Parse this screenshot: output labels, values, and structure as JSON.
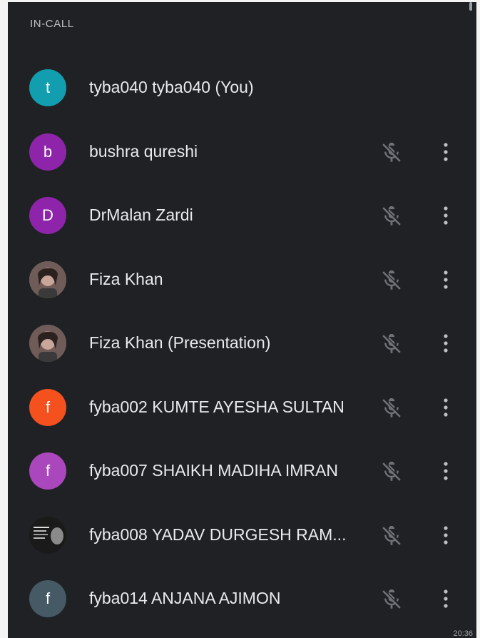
{
  "section_label": "IN-CALL",
  "participants": [
    {
      "name": "tyba040 tyba040 (You)",
      "initial": "t",
      "avatar_color": "#129eaf",
      "avatar_type": "initial",
      "muted": false,
      "has_menu": false
    },
    {
      "name": "bushra qureshi",
      "initial": "b",
      "avatar_color": "#8e24aa",
      "avatar_type": "initial",
      "muted": true,
      "has_menu": true
    },
    {
      "name": "DrMalan Zardi",
      "initial": "D",
      "avatar_color": "#8e24aa",
      "avatar_type": "initial",
      "muted": true,
      "has_menu": true
    },
    {
      "name": "Fiza Khan",
      "initial": "",
      "avatar_color": "#6f5b58",
      "avatar_type": "photo",
      "muted": true,
      "has_menu": true
    },
    {
      "name": "Fiza Khan (Presentation)",
      "initial": "",
      "avatar_color": "#6f5b58",
      "avatar_type": "photo",
      "muted": true,
      "has_menu": true
    },
    {
      "name": "fyba002 KUMTE AYESHA SULTAN",
      "initial": "f",
      "avatar_color": "#f4511e",
      "avatar_type": "initial",
      "muted": true,
      "has_menu": true
    },
    {
      "name": "fyba007 SHAIKH MADIHA IMRAN",
      "initial": "f",
      "avatar_color": "#ab47bc",
      "avatar_type": "initial",
      "muted": true,
      "has_menu": true
    },
    {
      "name": "fyba008 YADAV DURGESH RAM...",
      "initial": "",
      "avatar_color": "#1e1e1e",
      "avatar_type": "poster",
      "muted": true,
      "has_menu": true
    },
    {
      "name": "fyba014 ANJANA AJIMON",
      "initial": "f",
      "avatar_color": "#455a64",
      "avatar_type": "initial",
      "muted": true,
      "has_menu": true
    }
  ],
  "status_time": "20:36"
}
